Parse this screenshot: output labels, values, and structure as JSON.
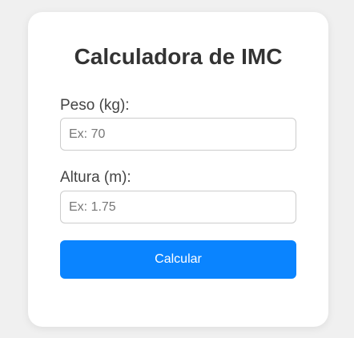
{
  "app": {
    "title": "Calculadora de IMC"
  },
  "form": {
    "peso": {
      "label": "Peso (kg):",
      "value": "",
      "placeholder": "Ex: 70"
    },
    "altura": {
      "label": "Altura (m):",
      "value": "",
      "placeholder": "Ex: 1.75"
    },
    "submit_label": "Calcular"
  },
  "colors": {
    "background": "#f0f0f0",
    "card": "#ffffff",
    "accent": "#0a84ff",
    "title_text": "#333333",
    "label_text": "#444444"
  }
}
